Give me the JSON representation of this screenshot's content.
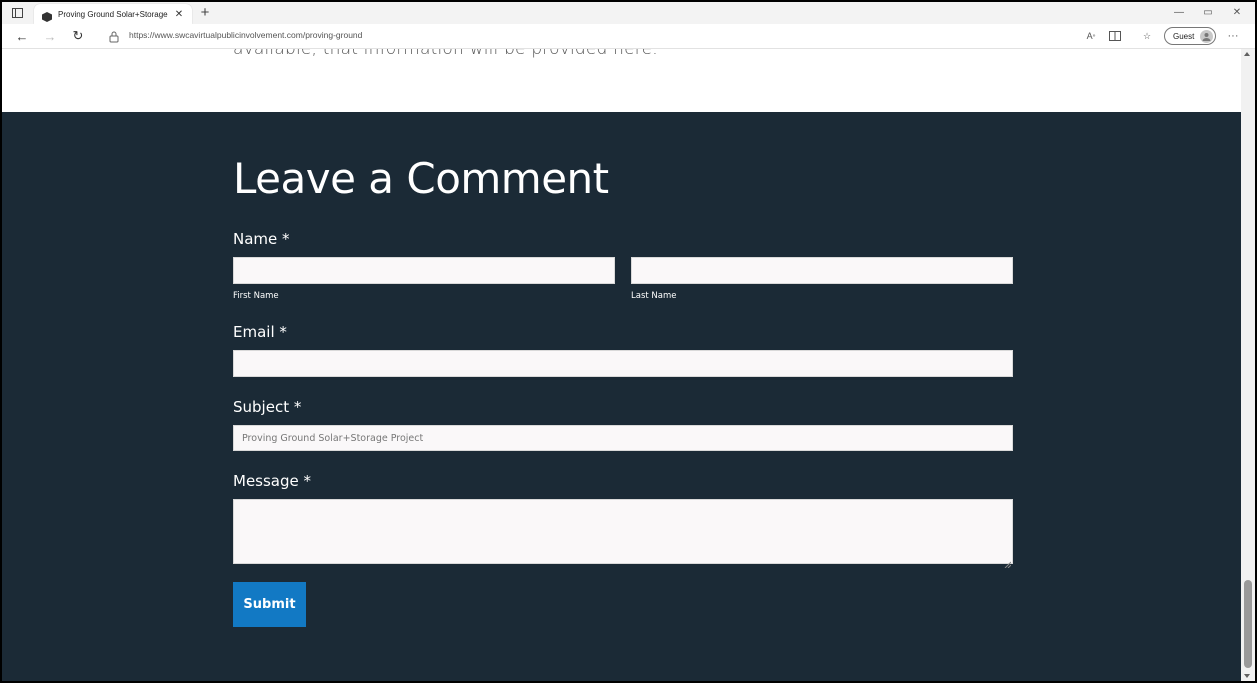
{
  "browser": {
    "tab_title": "Proving Ground Solar+Storage P",
    "url": "https://www.swcavirtualpublicinvolvement.com/proving-ground",
    "profile_label": "Guest"
  },
  "page": {
    "top_text": "available, that information will be provided here.",
    "heading": "Leave a Comment",
    "form": {
      "name_label": "Name *",
      "first_name_label": "First Name",
      "last_name_label": "Last Name",
      "email_label": "Email *",
      "subject_label": "Subject *",
      "subject_value": "Proving Ground Solar+Storage Project",
      "message_label": "Message *",
      "submit_label": "Submit"
    }
  },
  "colors": {
    "dark_section": "#1b2a36",
    "submit_button": "#1279c4"
  },
  "icons": [
    "tab-actions-icon",
    "favicon",
    "tab-close-icon",
    "new-tab-icon",
    "minimize-icon",
    "restore-icon",
    "window-close-icon",
    "back-icon",
    "forward-icon",
    "refresh-icon",
    "lock-icon",
    "read-aloud-icon",
    "immersive-reader-icon",
    "favorites-icon",
    "avatar-icon",
    "more-icon"
  ]
}
